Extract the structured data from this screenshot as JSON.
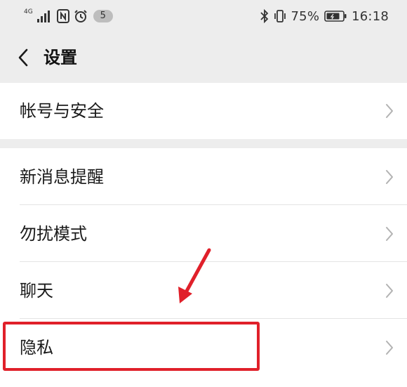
{
  "status_bar": {
    "network": "4G",
    "notification_count": "5",
    "battery": "75%",
    "time": "16:18",
    "icons": [
      "signal-icon",
      "nfc-icon",
      "alarm-icon",
      "bluetooth-icon",
      "vibrate-icon",
      "battery-icon"
    ]
  },
  "header": {
    "title": "设置"
  },
  "groups": [
    {
      "items": [
        {
          "label": "帐号与安全"
        }
      ]
    },
    {
      "items": [
        {
          "label": "新消息提醒"
        },
        {
          "label": "勿扰模式"
        },
        {
          "label": "聊天"
        },
        {
          "label": "隐私"
        }
      ]
    }
  ],
  "annotation": {
    "highlighted_item": "隐私",
    "color": "#e0202a"
  },
  "colors": {
    "background": "#ededed",
    "card": "#ffffff",
    "divider": "#e4e4e4",
    "annotation_red": "#e0202a"
  }
}
